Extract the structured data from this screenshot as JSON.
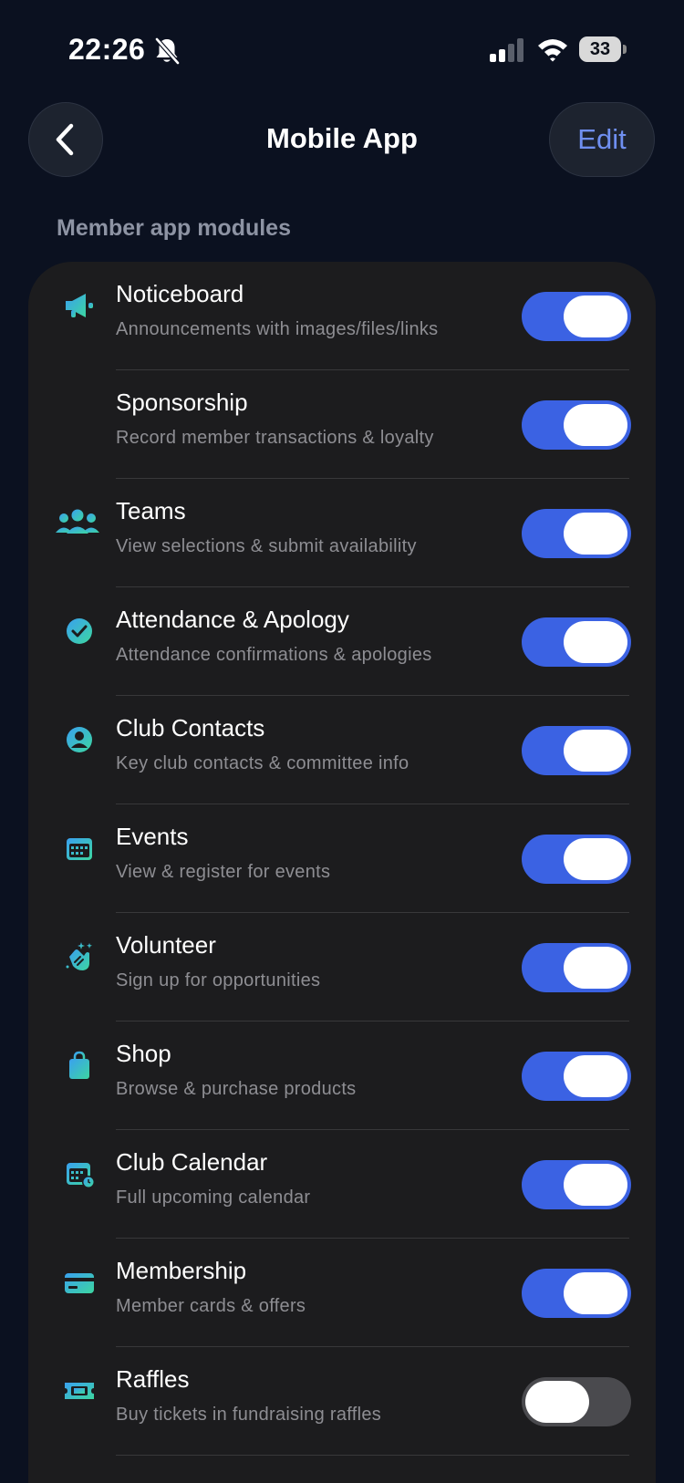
{
  "status_bar": {
    "time": "22:26",
    "battery": "33",
    "icons": [
      "bell-slash-icon",
      "cellular-signal-icon",
      "wifi-icon",
      "battery-icon"
    ]
  },
  "header": {
    "back_icon": "chevron-left-icon",
    "title": "Mobile App",
    "edit_label": "Edit"
  },
  "section": {
    "label": "Member app modules"
  },
  "colors": {
    "background": "#0b1120",
    "card": "#1c1c1e",
    "toggle_on": "#3b62e3",
    "toggle_off": "#4a4a4e",
    "accent_text": "#6f8ff0",
    "icon_gradient_start": "#3aa0f0",
    "icon_gradient_end": "#3cd6a0"
  },
  "modules": [
    {
      "title": "Noticeboard",
      "subtitle": "Announcements with images/files/links",
      "icon": "megaphone-icon",
      "enabled": true
    },
    {
      "title": "Sponsorship",
      "subtitle": "Record member transactions & loyalty",
      "icon": "",
      "enabled": true
    },
    {
      "title": "Teams",
      "subtitle": "View selections & submit availability",
      "icon": "people-icon",
      "enabled": true
    },
    {
      "title": "Attendance & Apology",
      "subtitle": "Attendance confirmations & apologies",
      "icon": "checkmark-circle-icon",
      "enabled": true
    },
    {
      "title": "Club Contacts",
      "subtitle": "Key club contacts & committee info",
      "icon": "person-circle-icon",
      "enabled": true
    },
    {
      "title": "Events",
      "subtitle": "View & register for events",
      "icon": "calendar-icon",
      "enabled": true
    },
    {
      "title": "Volunteer",
      "subtitle": "Sign up for opportunities",
      "icon": "hands-clap-icon",
      "enabled": true
    },
    {
      "title": "Shop",
      "subtitle": "Browse & purchase products",
      "icon": "shopping-bag-icon",
      "enabled": true
    },
    {
      "title": "Club Calendar",
      "subtitle": "Full upcoming calendar",
      "icon": "calendar-clock-icon",
      "enabled": true
    },
    {
      "title": "Membership",
      "subtitle": "Member cards & offers",
      "icon": "credit-card-icon",
      "enabled": true
    },
    {
      "title": "Raffles",
      "subtitle": "Buy tickets in fundraising raffles",
      "icon": "ticket-icon",
      "enabled": false
    }
  ]
}
